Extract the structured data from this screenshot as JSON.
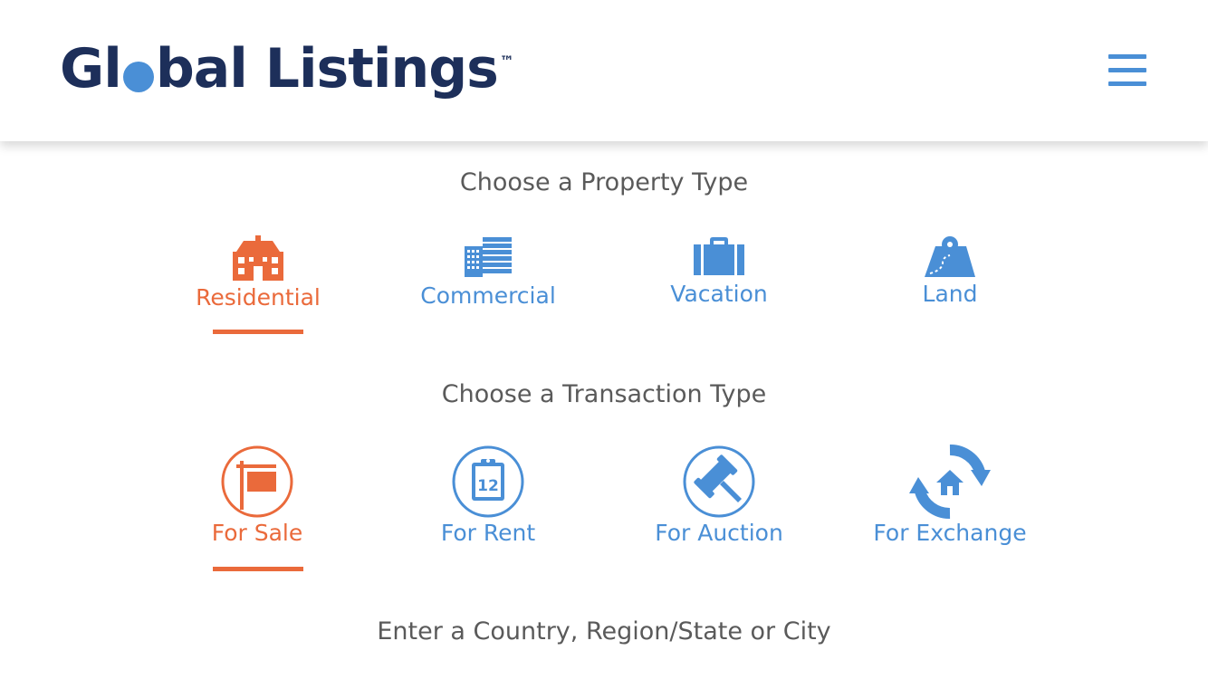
{
  "brand": {
    "logo_part1": "Gl",
    "logo_part2": "bal Listings",
    "trademark": "™",
    "colors": {
      "navy": "#1d2f5a",
      "blue": "#4a8fd6",
      "orange": "#ea6a3b"
    }
  },
  "header": {
    "menu_icon": "hamburger-menu-icon"
  },
  "property_section": {
    "title": "Choose a Property Type",
    "options": [
      {
        "label": "Residential",
        "icon": "house-icon",
        "selected": true
      },
      {
        "label": "Commercial",
        "icon": "office-building-icon",
        "selected": false
      },
      {
        "label": "Vacation",
        "icon": "suitcase-icon",
        "selected": false
      },
      {
        "label": "Land",
        "icon": "map-pin-icon",
        "selected": false
      }
    ]
  },
  "transaction_section": {
    "title": "Choose a Transaction Type",
    "options": [
      {
        "label": "For Sale",
        "icon": "for-sale-sign-icon",
        "selected": true
      },
      {
        "label": "For Rent",
        "icon": "calendar-clipboard-icon",
        "selected": false
      },
      {
        "label": "For Auction",
        "icon": "gavel-icon",
        "selected": false
      },
      {
        "label": "For Exchange",
        "icon": "house-exchange-icon",
        "selected": false
      }
    ]
  },
  "location_section": {
    "title": "Enter a Country, Region/State or City"
  },
  "rent_icon_day": "12"
}
